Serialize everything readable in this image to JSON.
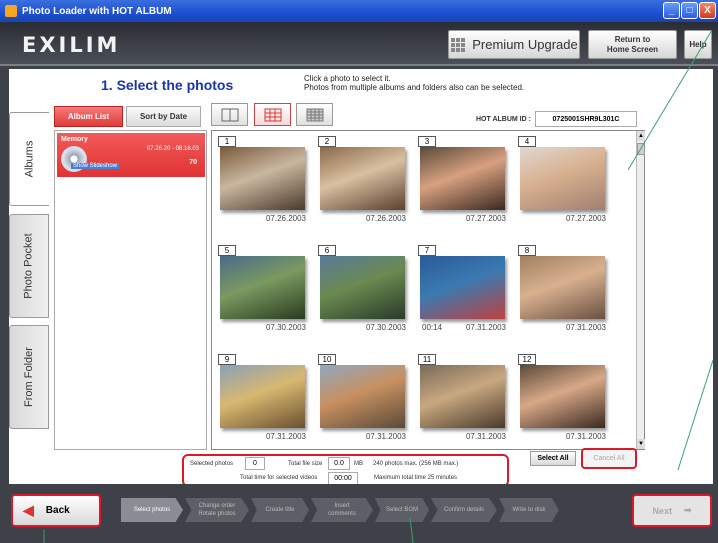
{
  "window": {
    "title": "Photo Loader with HOT ALBUM",
    "min": "_",
    "max": "□",
    "close": "X"
  },
  "topbar": {
    "logo": "EXILIM",
    "premium": "Premium Upgrade",
    "return": "Return to\nHome Screen",
    "help": "Help"
  },
  "sidetabs": [
    "Albums",
    "Photo Pocket",
    "From Folder"
  ],
  "header": {
    "title": "1. Select the photos",
    "instructions": "Click a photo to select it.\nPhotos from multiple albums and folders also can be selected."
  },
  "album_buttons": {
    "album_list": "Album List",
    "sort_by_date": "Sort by Date"
  },
  "album": {
    "name": "Memory",
    "dates": "07.26.20 - 08.16.03",
    "count": "70",
    "sub": "Show Slideshow"
  },
  "hotalbum": {
    "label": "HOT ALBUM ID :",
    "value": "0725001SHR9L301C"
  },
  "thumbnails": [
    {
      "num": "1",
      "date": "07.26.2003",
      "duration": "",
      "colors": [
        "#7a5a3a",
        "#c9b7a0",
        "#4a3a2a"
      ]
    },
    {
      "num": "2",
      "date": "07.26.2003",
      "duration": "",
      "colors": [
        "#8a6a4a",
        "#d8c0a0",
        "#5a4030"
      ]
    },
    {
      "num": "3",
      "date": "07.27.2003",
      "duration": "",
      "colors": [
        "#5a4a3a",
        "#d8a080",
        "#3a2a20"
      ]
    },
    {
      "num": "4",
      "date": "07.27.2003",
      "duration": "",
      "colors": [
        "#e0d8d0",
        "#d8b090",
        "#a08070"
      ]
    },
    {
      "num": "5",
      "date": "07.30.2003",
      "duration": "",
      "colors": [
        "#4a6a8a",
        "#7a9a60",
        "#2a3a20"
      ]
    },
    {
      "num": "6",
      "date": "07.30.2003",
      "duration": "",
      "colors": [
        "#5a7a9a",
        "#6a8a50",
        "#2a3a2a"
      ]
    },
    {
      "num": "7",
      "date": "07.31.2003",
      "duration": "00:14",
      "colors": [
        "#2a5a9a",
        "#3a7ab0",
        "#c04040"
      ]
    },
    {
      "num": "8",
      "date": "07.31.2003",
      "duration": "",
      "colors": [
        "#a08060",
        "#d8b090",
        "#6a5040"
      ]
    },
    {
      "num": "9",
      "date": "07.31.2003",
      "duration": "",
      "colors": [
        "#8aa0b8",
        "#d8b870",
        "#6a5030"
      ]
    },
    {
      "num": "10",
      "date": "07.31.2003",
      "duration": "",
      "colors": [
        "#90a8c0",
        "#c89060",
        "#5a4a3a"
      ]
    },
    {
      "num": "11",
      "date": "07.31.2003",
      "duration": "",
      "colors": [
        "#7a6a5a",
        "#c8a880",
        "#4a3a2a"
      ]
    },
    {
      "num": "12",
      "date": "07.31.2003",
      "duration": "",
      "colors": [
        "#5a4a3a",
        "#d8a888",
        "#3a2a20"
      ]
    }
  ],
  "status": {
    "selected_label": "Selected photos",
    "selected_value": "0",
    "size_label": "Total file size",
    "size_value": "0.0",
    "size_unit": "MB",
    "max_note": "240 photos max. (256 MB max.)",
    "time_label": "Total time for selected videos",
    "time_value": "00:00",
    "max_time_note": "Maximum total time 25 minutes"
  },
  "actions": {
    "select_all": "Select All",
    "cancel_all": "Cancel All"
  },
  "bottom": {
    "back": "Back",
    "next": "Next",
    "steps": [
      "Select photos",
      "Change order\nRotate photos",
      "Create title",
      "Insert\ncomments",
      "Select BGM",
      "Confirm details",
      "Write to disk"
    ]
  },
  "colors": {
    "accent_red": "#e0162b",
    "title_blue": "#1a35a8",
    "album_red": "#e13333"
  }
}
